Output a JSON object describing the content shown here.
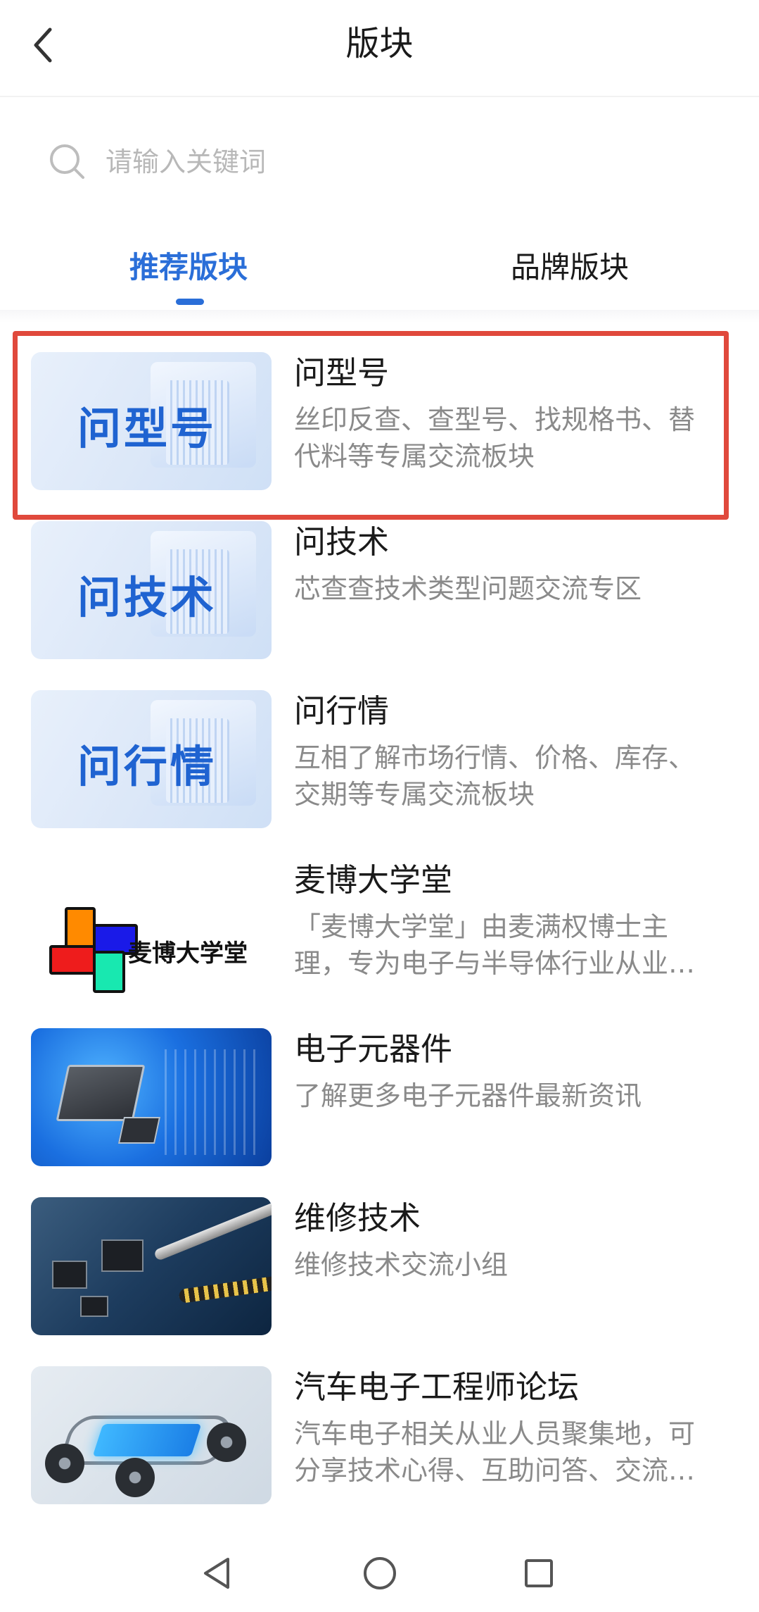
{
  "header": {
    "title": "版块"
  },
  "search": {
    "placeholder": "请输入关键词"
  },
  "tabs": [
    {
      "label": "推荐版块",
      "active": true
    },
    {
      "label": "品牌版块",
      "active": false
    }
  ],
  "items": [
    {
      "title": "问型号",
      "desc": "丝印反查、查型号、找规格书、替代料等专属交流板块",
      "thumb_text": "问型号"
    },
    {
      "title": "问技术",
      "desc": "芯查查技术类型问题交流专区",
      "thumb_text": "问技术"
    },
    {
      "title": "问行情",
      "desc": "互相了解市场行情、价格、库存、交期等专属交流板块",
      "thumb_text": "问行情"
    },
    {
      "title": "麦博大学堂",
      "desc": "「麦博大学堂」由麦满权博士主理，专为电子与半导体行业从业人员打造",
      "thumb_text": "麦博大学堂"
    },
    {
      "title": "电子元器件",
      "desc": "了解更多电子元器件最新资讯"
    },
    {
      "title": "维修技术",
      "desc": "维修技术交流小组"
    },
    {
      "title": "汽车电子工程师论坛",
      "desc": "汽车电子相关从业人员聚集地，可分享技术心得、互助问答、交流经验"
    }
  ],
  "colors": {
    "accent": "#2a6ed8",
    "highlight_border": "#e0493c",
    "desc_text": "#8a8a8a"
  },
  "navbar": {
    "icons": [
      "back-triangle-icon",
      "home-circle-icon",
      "recents-square-icon"
    ]
  }
}
